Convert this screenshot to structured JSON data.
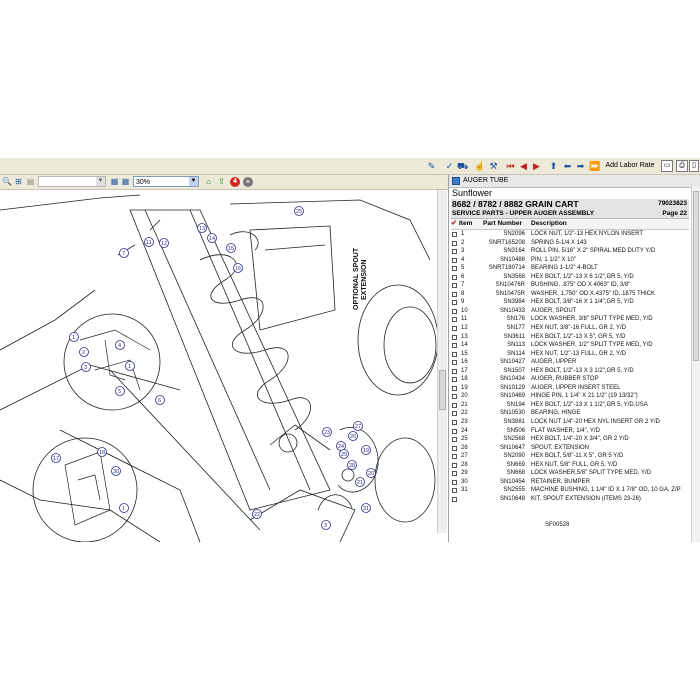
{
  "toolbar": {
    "add_labor_rate_label": "Add Labor Rate"
  },
  "viewer": {
    "zoom_value": "30%",
    "alert_count": "4",
    "drawing_label_lines": [
      "OPTIONAL SPOUT",
      "EXTENSION"
    ],
    "callouts": [
      "25",
      "11",
      "12",
      "7",
      "13",
      "14",
      "15",
      "16",
      "1",
      "2",
      "3",
      "4",
      "1",
      "5",
      "6",
      "17",
      "18",
      "30",
      "1",
      "22",
      "23",
      "24",
      "29",
      "28",
      "21",
      "31",
      "3",
      "20",
      "19",
      "26",
      "27"
    ]
  },
  "document": {
    "header_title": "AUGER TUBE",
    "brand": "Sunflower",
    "catalog": "8682 / 8782 / 8882 GRAIN CART",
    "catalog_number": "79023823",
    "section": "SERVICE PARTS - UPPER AUGER ASSEMBLY",
    "page": "Page 22",
    "columns": {
      "item": "Item",
      "part": "Part Number",
      "desc": "Description"
    },
    "rows": [
      {
        "item": "1",
        "part": "SN2096",
        "desc": "LOCK NUT, 1/2\"-13 HEX NYLON INSERT"
      },
      {
        "item": "2",
        "part": "SNRT165208",
        "desc": "SPRING 5-1/4 X 143"
      },
      {
        "item": "3",
        "part": "SN3164",
        "desc": "ROLL PIN, 5/16\" X 2\" SPIRAL MED DUTY Y/D"
      },
      {
        "item": "4",
        "part": "SN10488",
        "desc": "PIN, 1 1/2\" X 10\""
      },
      {
        "item": "5",
        "part": "SNRT180714",
        "desc": "BEARING 1-1/2\" 4-BOLT"
      },
      {
        "item": "6",
        "part": "SN3568",
        "desc": "HEX BOLT, 1/2\"-13 X 6 1/2\",GR 5, Y/D"
      },
      {
        "item": "7",
        "part": "SN10476R",
        "desc": "BUSHING, .875\" OD X 4063\" ID, 3/8\""
      },
      {
        "item": "8",
        "part": "SN10475R",
        "desc": "WASHER, 1.750\" OD X.4375\" ID,.1875 THICK"
      },
      {
        "item": "9",
        "part": "SN3984",
        "desc": "HEX BOLT, 3/8\"-16 X 1 1/4\",GR 5, Y/D"
      },
      {
        "item": "10",
        "part": "SN10433",
        "desc": "AUGER, SPOUT"
      },
      {
        "item": "11",
        "part": "SN176",
        "desc": "LOCK WASHER, 3/8\" SPLIT TYPE MED, Y/D"
      },
      {
        "item": "12",
        "part": "SN177",
        "desc": "HEX NUT, 3/8\"-16 FULL, GR 2, Y/D"
      },
      {
        "item": "13",
        "part": "SN3611",
        "desc": "HEX BOLT, 1/2\"-13 X 5\", GR 5, Y/D"
      },
      {
        "item": "14",
        "part": "SN113",
        "desc": "LOCK WASHER, 1/2\" SPLIT TYPE MED, Y/D"
      },
      {
        "item": "15",
        "part": "SN114",
        "desc": "HEX NUT, 1/2\"-13 FULL, GR 2, Y/D"
      },
      {
        "item": "16",
        "part": "SN10427",
        "desc": "AUGER, UPPER"
      },
      {
        "item": "17",
        "part": "SN1507",
        "desc": "HEX BOLT, 1/2\"-13 X 3 1/2\",GR 5, Y/D"
      },
      {
        "item": "18",
        "part": "SN10434",
        "desc": "AUGER, RUBBER STOP"
      },
      {
        "item": "19",
        "part": "SN10129",
        "desc": "AUGER, UPPER INSERT STEEL"
      },
      {
        "item": "20",
        "part": "SN10469",
        "desc": "HINGE PIN, 1 1/4\" X 21 1/2\" (19 13/32\")"
      },
      {
        "item": "21",
        "part": "SN194",
        "desc": "HEX BOLT, 1/2\"-13 X 1 1/2\",GR 5, Y/D,USA"
      },
      {
        "item": "22",
        "part": "SN10530",
        "desc": "BEARING, HINGE"
      },
      {
        "item": "23",
        "part": "SN3881",
        "desc": "LOCK NUT 1/4\"-20 HEX NYL INSERT GR 2 Y/D"
      },
      {
        "item": "24",
        "part": "SN506",
        "desc": "FLAT WASHER, 1/4\", Y/D"
      },
      {
        "item": "25",
        "part": "SN2568",
        "desc": "HEX BOLT, 1/4\"-20 X 3/4\", GR 2 Y/D"
      },
      {
        "item": "26",
        "part": "SN10647",
        "desc": "SPOUT, EXTENSION"
      },
      {
        "item": "27",
        "part": "SN2090",
        "desc": "HEX BOLT, 5/8\"-11 X 5\", GR 5 Y/D"
      },
      {
        "item": "28",
        "part": "SN669",
        "desc": "HEX NUT, 5/8\" FULL, GR 5, Y/D"
      },
      {
        "item": "29",
        "part": "SN668",
        "desc": "LOCK WASHER,5/8\" SPLIT TYPE MED, Y/D"
      },
      {
        "item": "30",
        "part": "SN10454",
        "desc": "RETAINER, BUMPER"
      },
      {
        "item": "31",
        "part": "SN2555",
        "desc": "MACHINE BUSHING, 1 1/4\" ID X 1 7/8\" OD, 10 GA, Z/P"
      },
      {
        "item": "",
        "part": "SN10648",
        "desc": "KIT, SPOUT EXTENSION (ITEMS 23-26)"
      }
    ],
    "ref_code": "SF00528"
  },
  "colors": {
    "accent": "#2a2f8a",
    "alert": "#d0281e",
    "toolbar_bg": "#ece9d8"
  }
}
